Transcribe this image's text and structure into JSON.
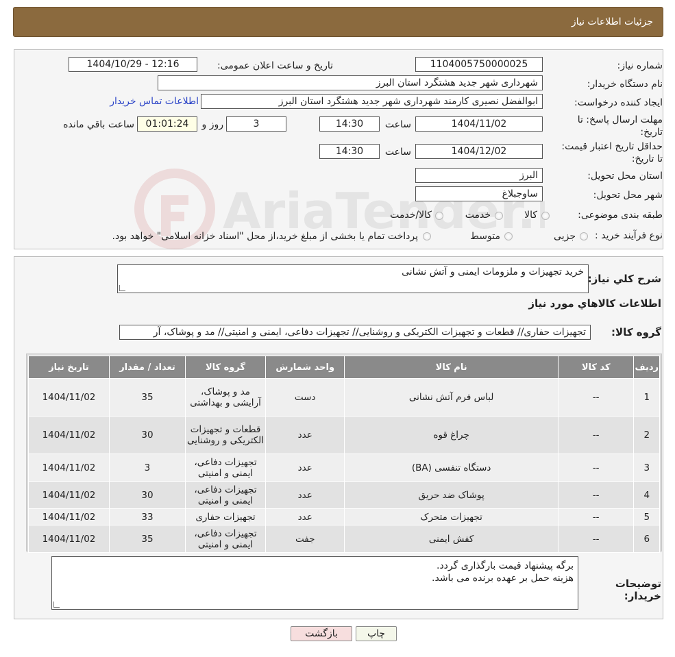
{
  "header": {
    "title": "جزئیات اطلاعات نیاز"
  },
  "info": {
    "need_number_label": "شماره نیاز:",
    "need_number": "1104005750000025",
    "announce_label": "تاریخ و ساعت اعلان عمومی:",
    "announce_value": "1404/10/29 - 12:16",
    "buyer_label": "نام دستگاه خریدار:",
    "buyer_value": "شهرداری شهر جدید هشتگرد استان البرز",
    "creator_label": "ایجاد کننده درخواست:",
    "creator_value": "ابوالفضل نصیری کارمند شهرداری شهر جدید هشتگرد استان البرز",
    "contact_link": "اطلاعات تماس خریدار",
    "deadline_label": "مهلت ارسال پاسخ: تا تاریخ:",
    "deadline_date": "1404/11/02",
    "time_label": "ساعت",
    "deadline_time": "14:30",
    "days_value": "3",
    "days_label": "روز و",
    "remaining_value": "01:01:24",
    "remaining_label": "ساعت باقي مانده",
    "validity_label": "حداقل تاریخ اعتبار قیمت: تا تاریخ:",
    "validity_date": "1404/12/02",
    "validity_time": "14:30",
    "province_label": "استان محل تحویل:",
    "province_value": "البرز",
    "city_label": "شهر محل تحویل:",
    "city_value": "ساوجبلاغ",
    "category_label": "طبقه بندی موضوعی:",
    "category_options": [
      "کالا",
      "خدمت",
      "کالا/خدمت"
    ],
    "process_label": "نوع فرآیند خرید :",
    "process_options": [
      "جزیی",
      "متوسط"
    ],
    "process_note": "پرداخت تمام یا بخشی از مبلغ خرید،از محل \"اسناد خزانه اسلامی\" خواهد بود."
  },
  "watermark": {
    "text": "AriaTender.net"
  },
  "details": {
    "desc_label": "شرح کلي نياز:",
    "desc_value": "خرید تجهیزات و ملزومات ایمنی و آتش نشانی",
    "goods_heading": "اطلاعات کالاهاي مورد نياز",
    "group_label": "گروه کالا:",
    "group_value": "تجهیزات حفاری// قطعات و تجهیزات الکتریکی و روشنایی// تجهیزات دفاعی، ایمنی و امنیتی// مد و پوشاک، آر",
    "table": {
      "headers": [
        "رديف",
        "کد کالا",
        "نام کالا",
        "واحد شمارش",
        "گروه کالا",
        "تعداد / مقدار",
        "تاریخ نیاز"
      ],
      "rows": [
        [
          "1",
          "--",
          "لباس فرم آتش نشانی",
          "دست",
          "مد و پوشاک، آرایشی و بهداشتی",
          "35",
          "1404/11/02"
        ],
        [
          "2",
          "--",
          "چراغ قوه",
          "عدد",
          "قطعات و تجهیزات الکتریکی و روشنایی",
          "30",
          "1404/11/02"
        ],
        [
          "3",
          "--",
          "دستگاه تنفسی (BA)",
          "عدد",
          "تجهیزات دفاعی، ایمنی و امنیتی",
          "3",
          "1404/11/02"
        ],
        [
          "4",
          "--",
          "پوشاک ضد حریق",
          "عدد",
          "تجهیزات دفاعی، ایمنی و امنیتی",
          "30",
          "1404/11/02"
        ],
        [
          "5",
          "--",
          "تجهیزات متحرک",
          "عدد",
          "تجهیزات حفاری",
          "33",
          "1404/11/02"
        ],
        [
          "6",
          "--",
          "کفش ایمنی",
          "جفت",
          "تجهیزات دفاعی، ایمنی و امنیتی",
          "35",
          "1404/11/02"
        ]
      ]
    },
    "buyer_notes_label": "توضیحات خریدار:",
    "buyer_notes_line1": "برگه پیشنهاد قیمت بارگذاری گردد.",
    "buyer_notes_line2": "هزینه حمل بر عهده برنده می باشد."
  },
  "buttons": {
    "print": "چاپ",
    "back": "بازگشت"
  }
}
